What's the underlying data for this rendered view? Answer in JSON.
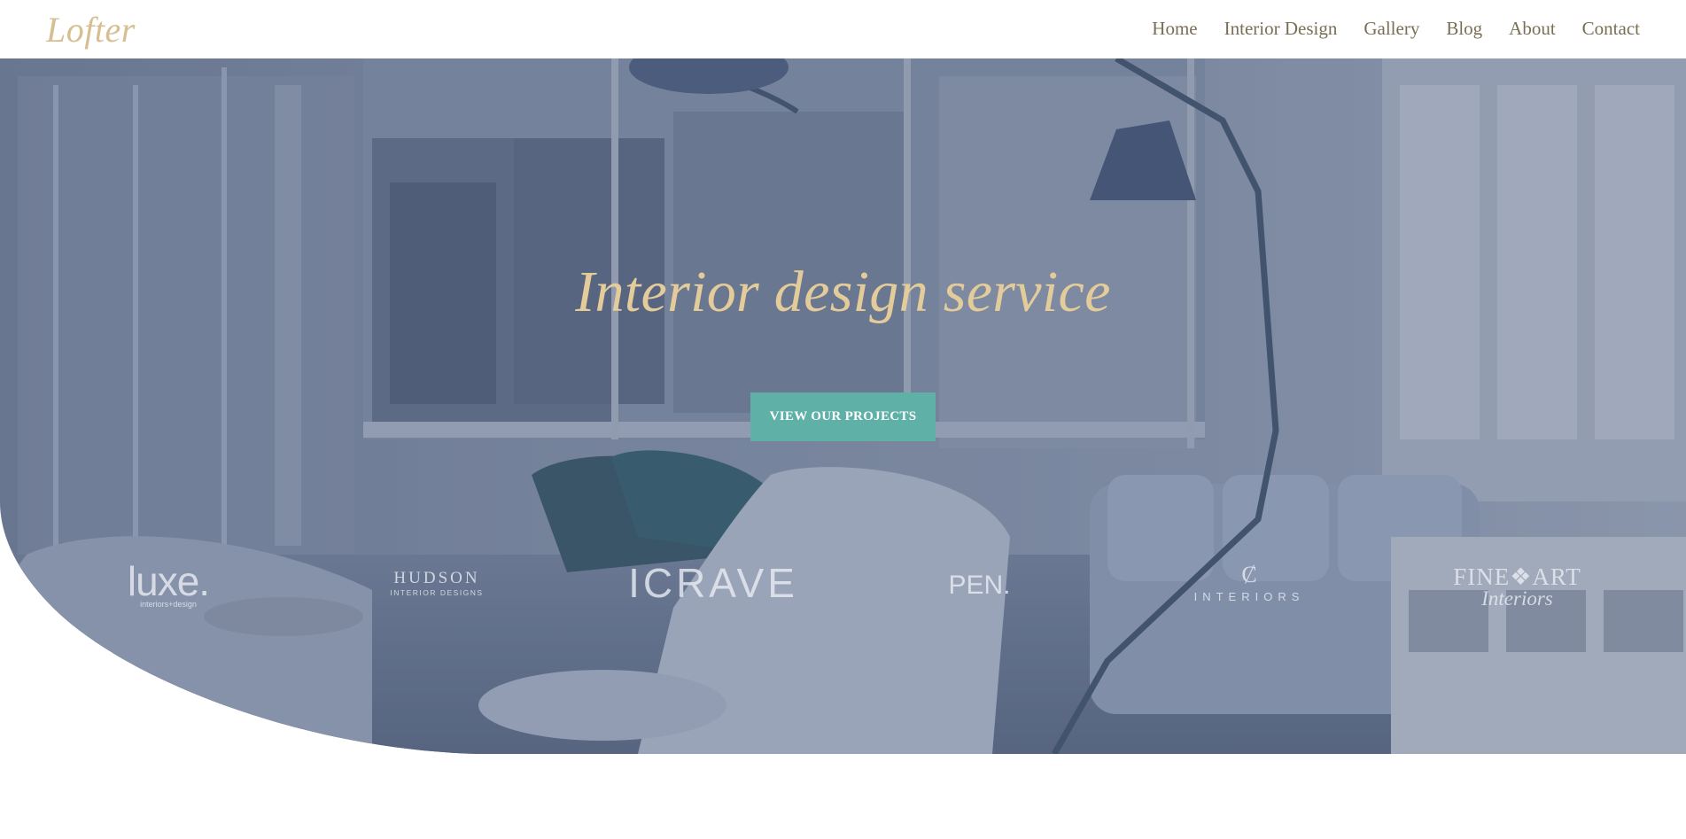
{
  "logo": "Lofter",
  "nav": {
    "items": [
      "Home",
      "Interior Design",
      "Gallery",
      "Blog",
      "About",
      "Contact"
    ]
  },
  "hero": {
    "title": "Interior design service",
    "cta_label": "VIEW OUR PROJECTS"
  },
  "brands": {
    "luxe": {
      "name": "luxe.",
      "tagline": "interiors+design"
    },
    "hudson": {
      "name": "HUDSON",
      "tagline": "INTERIOR DESIGNS"
    },
    "crave": {
      "name": "ICRAVE"
    },
    "pen": {
      "name": "PEN."
    },
    "interiors": {
      "mark": "Ȼ",
      "name": "INTERIORS"
    },
    "fineart": {
      "name": "FINE❖ART",
      "tagline": "Interiors"
    }
  },
  "colors": {
    "accent_gold": "#d6bf92",
    "hero_title": "#e3cc9a",
    "cta_bg": "#5fb0a7",
    "nav_text": "#7a6f55"
  }
}
